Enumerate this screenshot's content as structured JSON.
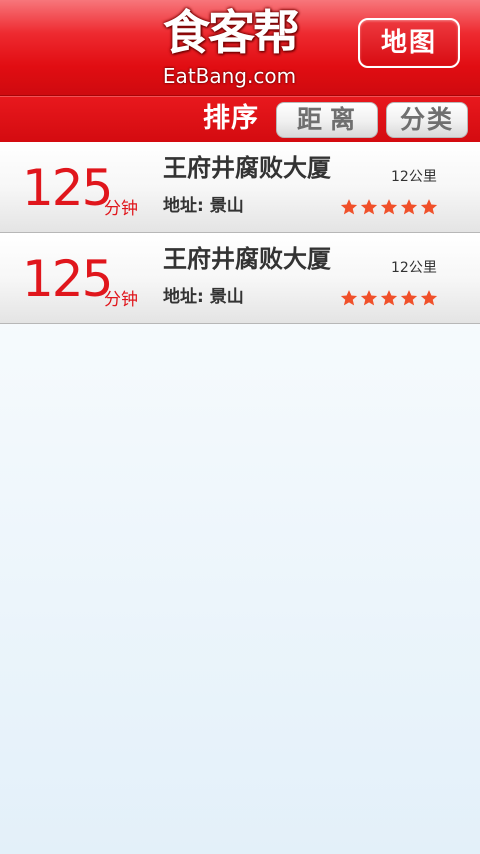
{
  "header": {
    "logo_text": "食客帮",
    "logo_sub": "EatBang.com",
    "map_button": "地图"
  },
  "sort_bar": {
    "label": "排序",
    "distance_button": "距离",
    "category_button": "分类"
  },
  "list": [
    {
      "time_value": "125",
      "time_unit": "分钟",
      "name": "王府井腐败大厦",
      "distance": "12公里",
      "address": "地址: 景山",
      "rating": 5
    },
    {
      "time_value": "125",
      "time_unit": "分钟",
      "name": "王府井腐败大厦",
      "distance": "12公里",
      "address": "地址: 景山",
      "rating": 5
    }
  ],
  "colors": {
    "brand_red": "#e10d12",
    "time_red": "#e0161c",
    "star_orange": "#f0502a"
  },
  "icons": {
    "rating": "star-icon"
  }
}
